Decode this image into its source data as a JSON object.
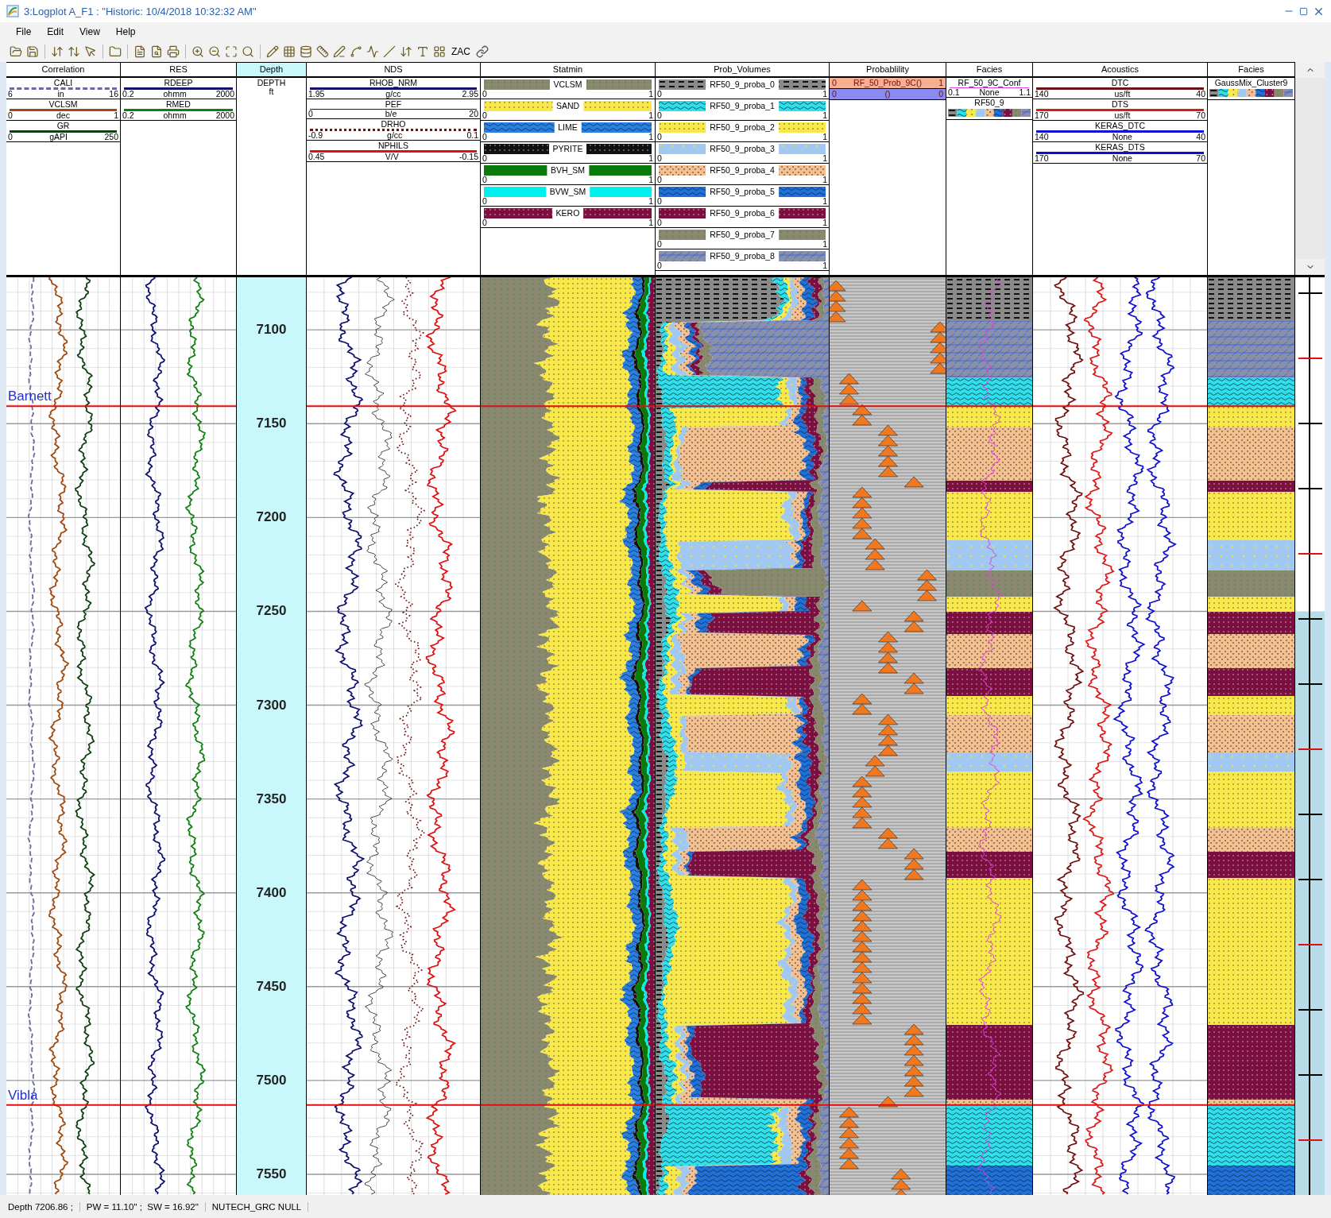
{
  "window": {
    "title": "3:Logplot A_F1 : \"Historic: 10/4/2018 10:32:32 AM\""
  },
  "menu": [
    "File",
    "Edit",
    "View",
    "Help"
  ],
  "toolbar": {
    "text_button": "ZAC"
  },
  "tracks": [
    {
      "title": "Correlation",
      "kind": "curves",
      "entries": [
        {
          "kind": "curve",
          "name": "CALI",
          "unit": "in",
          "min": "6",
          "max": "16",
          "color": "#6a6aa0",
          "line": {
            "kind": "dashed"
          }
        },
        {
          "kind": "curve",
          "name": "VCLSM",
          "unit": "dec",
          "min": "0",
          "max": "1",
          "color": "#a04a10",
          "line": {
            "kind": "solid"
          }
        },
        {
          "kind": "curve",
          "name": "GR",
          "unit": "gAPI",
          "min": "0",
          "max": "250",
          "color": "#104010",
          "line": {
            "kind": "solid"
          }
        }
      ]
    },
    {
      "title": "RES",
      "kind": "curves",
      "entries": [
        {
          "kind": "curve",
          "name": "RDEEP",
          "unit": "ohmm",
          "min": "0.2",
          "max": "2000",
          "color": "#101070",
          "line": {
            "kind": "solid"
          }
        },
        {
          "kind": "curve",
          "name": "RMED",
          "unit": "ohmm",
          "min": "0.2",
          "max": "2000",
          "color": "#108010",
          "line": {
            "kind": "solid"
          }
        }
      ]
    },
    {
      "title": "Depth",
      "kind": "depth",
      "entries": [
        {
          "kind": "depth",
          "name": "DEPTH",
          "unit": "ft"
        }
      ],
      "labels": [
        "7100",
        "7150",
        "7200",
        "7250",
        "7300",
        "7350",
        "7400",
        "7450",
        "7500",
        "7550"
      ]
    },
    {
      "title": "NDS",
      "kind": "curves",
      "entries": [
        {
          "kind": "curve",
          "name": "RHOB_NRM",
          "unit": "g/cc",
          "min": "1.95",
          "max": "2.95",
          "color": "#101070",
          "line": {
            "kind": "solid"
          }
        },
        {
          "kind": "curve",
          "name": "PEF",
          "unit": "b/e",
          "min": "0",
          "max": "20",
          "color": "#202020",
          "line": {
            "kind": "thin"
          }
        },
        {
          "kind": "curve",
          "name": "DRHO",
          "unit": "g/cc",
          "min": "-0.9",
          "max": "0.1",
          "color": "#701010",
          "line": {
            "kind": "dotted"
          }
        },
        {
          "kind": "curve",
          "name": "NPHILS",
          "unit": "V/V",
          "min": "0.45",
          "max": "-0.15",
          "color": "#e01010",
          "line": {
            "kind": "solid"
          }
        }
      ]
    },
    {
      "title": "Statmin",
      "kind": "stack",
      "entries": [
        {
          "kind": "fill",
          "name": "VCLSM",
          "min": "0",
          "max": "1",
          "color": "#8c8770",
          "pattern": {
            "kind": "shale"
          }
        },
        {
          "kind": "fill",
          "name": "SAND",
          "min": "0",
          "max": "1",
          "color": "#f8e84a",
          "pattern": {
            "kind": "dots"
          }
        },
        {
          "kind": "fill",
          "name": "LIME",
          "min": "0",
          "max": "1",
          "color": "#2a7fe0",
          "pattern": {
            "kind": "bricks"
          }
        },
        {
          "kind": "fill",
          "name": "PYRITE",
          "min": "0",
          "max": "1",
          "color": "#111111",
          "pattern": {
            "kind": "whitedots"
          }
        },
        {
          "kind": "fill",
          "name": "BVH_SM",
          "min": "0",
          "max": "1",
          "color": "#0a7a0a",
          "pattern": {
            "kind": "solid"
          }
        },
        {
          "kind": "fill",
          "name": "BVW_SM",
          "min": "0",
          "max": "1",
          "color": "#00f0f0",
          "pattern": {
            "kind": "solid"
          }
        },
        {
          "kind": "fill",
          "name": "KERO",
          "min": "0",
          "max": "1",
          "color": "#7a1040",
          "pattern": {
            "kind": "whitedots"
          }
        }
      ]
    },
    {
      "title": "Prob_Volumes",
      "kind": "class_stack",
      "entries": [
        {
          "kind": "fill",
          "name": "RF50_9_proba_0",
          "min": "0",
          "max": "1",
          "color": "#8a8a8a",
          "pattern": {
            "kind": "dashes"
          }
        },
        {
          "kind": "fill",
          "name": "RF50_9_proba_1",
          "min": "0",
          "max": "1",
          "color": "#30e0e8",
          "pattern": {
            "kind": "bricks"
          }
        },
        {
          "kind": "fill",
          "name": "RF50_9_proba_2",
          "min": "0",
          "max": "1",
          "color": "#f8e84a",
          "pattern": {
            "kind": "dots"
          }
        },
        {
          "kind": "fill",
          "name": "RF50_9_proba_3",
          "min": "0",
          "max": "1",
          "color": "#a0c8f0",
          "pattern": {
            "kind": "sparkles"
          }
        },
        {
          "kind": "fill",
          "name": "RF50_9_proba_4",
          "min": "0",
          "max": "1",
          "color": "#f4c090",
          "pattern": {
            "kind": "speckle"
          }
        },
        {
          "kind": "fill",
          "name": "RF50_9_proba_5",
          "min": "0",
          "max": "1",
          "color": "#2070d8",
          "pattern": {
            "kind": "bricks"
          }
        },
        {
          "kind": "fill",
          "name": "RF50_9_proba_6",
          "min": "0",
          "max": "1",
          "color": "#7a1040",
          "pattern": {
            "kind": "whitedots"
          }
        },
        {
          "kind": "fill",
          "name": "RF50_9_proba_7",
          "min": "0",
          "max": "1",
          "color": "#8c8770",
          "pattern": {
            "kind": "shale"
          }
        },
        {
          "kind": "fill",
          "name": "RF50_9_proba_8",
          "min": "0",
          "max": "1",
          "color": "#8a90a8",
          "pattern": {
            "kind": "slabs"
          }
        }
      ]
    },
    {
      "title": "Probablility",
      "kind": "probability",
      "entries": [
        {
          "kind": "band",
          "name": "RF_50_Prob_9C()",
          "min": "0",
          "max": "1",
          "color": "#f8b090"
        },
        {
          "kind": "band",
          "name": "()",
          "min": "0",
          "max": "0",
          "color": "#8a8af0"
        }
      ]
    },
    {
      "title": "Facies",
      "kind": "facies",
      "entries": [
        {
          "kind": "curve",
          "name": "RF_50_9C_Conf",
          "unit": "None",
          "min": "0.1",
          "max": "1.1",
          "color": "#e040e0",
          "line": {
            "kind": "thin"
          }
        },
        {
          "kind": "legend",
          "name": "RF50_9"
        }
      ]
    },
    {
      "title": "Acoustics",
      "kind": "curves",
      "entries": [
        {
          "kind": "curve",
          "name": "DTC",
          "unit": "us/ft",
          "min": "140",
          "max": "40",
          "color": "#701010",
          "line": {
            "kind": "solid"
          }
        },
        {
          "kind": "curve",
          "name": "DTS",
          "unit": "us/ft",
          "min": "170",
          "max": "70",
          "color": "#e01818",
          "line": {
            "kind": "solid"
          }
        },
        {
          "kind": "curve",
          "name": "KERAS_DTC",
          "unit": "None",
          "min": "140",
          "max": "40",
          "color": "#1010d0",
          "line": {
            "kind": "solid"
          }
        },
        {
          "kind": "curve",
          "name": "KERAS_DTS",
          "unit": "None",
          "min": "170",
          "max": "70",
          "color": "#1010d0",
          "line": {
            "kind": "solid"
          }
        }
      ]
    },
    {
      "title": "Facies",
      "kind": "facies",
      "entries": [
        {
          "kind": "legend",
          "name": "GaussMix_Cluster9"
        }
      ]
    }
  ],
  "formation_tops": [
    {
      "name": "Barnett"
    },
    {
      "name": "Vibla"
    }
  ],
  "status_bar": [
    "Depth 7206.86 ;",
    "PW = 11.10\" ;  SW = 16.92\"",
    "NUTECH_GRC NULL"
  ]
}
